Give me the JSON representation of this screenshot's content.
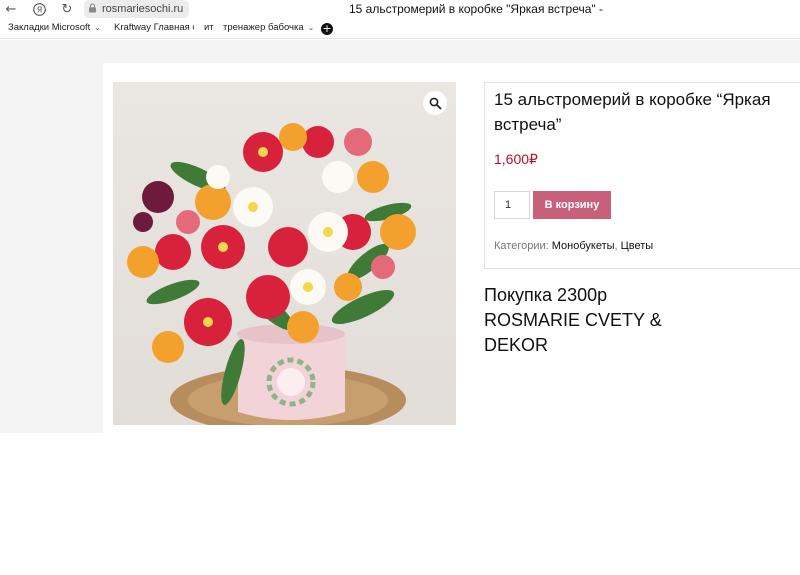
{
  "browser": {
    "address": "rosmariesochi.ru",
    "tab_title": "15 альстромерий в коробке \"Яркая встреча\" -",
    "icons": {
      "back": "back-arrow-icon",
      "yandex": "yandex-logo-icon",
      "reload": "reload-icon",
      "lock": "lock-icon"
    }
  },
  "bookmarks": [
    {
      "label": "Закладки Microsoft",
      "has_menu": true
    },
    {
      "label": "Kraftway Главная ст...",
      "has_menu": false
    },
    {
      "label": "ит",
      "has_menu": false
    },
    {
      "label": "тренажер бабочка",
      "has_menu": true
    }
  ],
  "product": {
    "title": "15 альстромерий в коробке “Яркая встреча”",
    "price": "1,600₽",
    "quantity": "1",
    "add_to_cart": "В корзину",
    "categories_label": "Категории:",
    "categories": [
      "Монобукеты",
      "Цветы"
    ],
    "image_alt": "bouquet of alstroemeria in a pink round box"
  },
  "note": {
    "line1": "Покупка 2300р",
    "line2": "ROSMARIE CVETY &",
    "line3": "DEKOR"
  },
  "colors": {
    "price": "#b3122a",
    "button": "#c8607c",
    "page_bg": "#f4f4f4"
  }
}
